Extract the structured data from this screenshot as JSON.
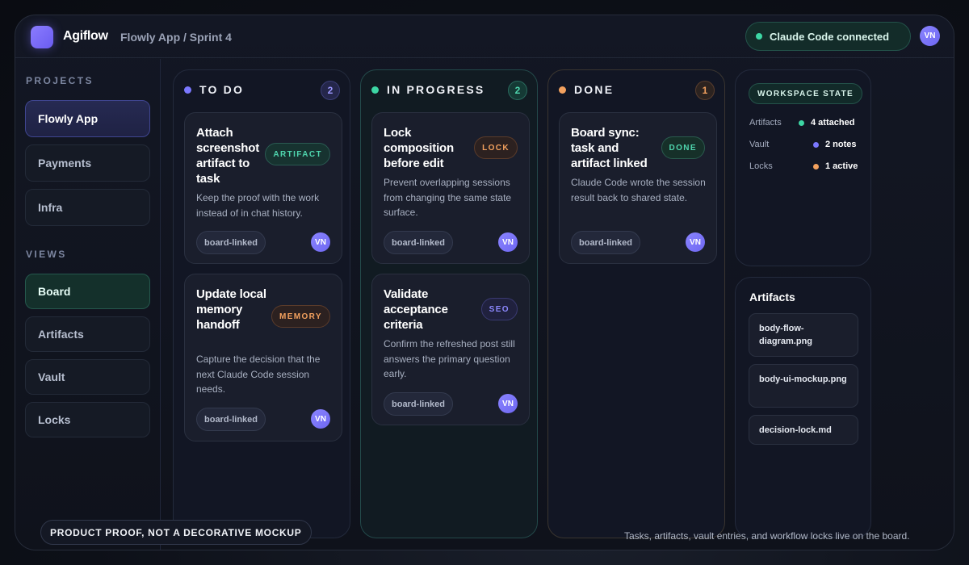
{
  "app": {
    "brand": "Agiflow",
    "breadcrumb": "Flowly App / Sprint 4",
    "status": "Claude Code connected",
    "user_initials": "VN"
  },
  "sidebar": {
    "projects_label": "PROJECTS",
    "projects": [
      {
        "label": "Flowly App",
        "active": true
      },
      {
        "label": "Payments"
      },
      {
        "label": "Infra"
      }
    ],
    "views_label": "VIEWS",
    "views": [
      {
        "label": "Board",
        "active": true
      },
      {
        "label": "Artifacts"
      },
      {
        "label": "Vault"
      },
      {
        "label": "Locks"
      }
    ]
  },
  "columns": [
    {
      "title": "TO DO",
      "count": "2",
      "dot_color": "#7b78ff",
      "cards": [
        {
          "title": "Attach screenshot artifact to task",
          "tag": "ARTIFACT",
          "desc": "Keep the proof with the work instead of in chat history.",
          "chip": "board-linked",
          "avatar": "VN"
        },
        {
          "title": "Update local memory handoff",
          "tag": "MEMORY",
          "desc": "Capture the decision that the next Claude Code session needs.",
          "chip": "board-linked",
          "avatar": "VN"
        }
      ]
    },
    {
      "title": "IN PROGRESS",
      "count": "2",
      "dot_color": "#3dd6a4",
      "cards": [
        {
          "title": "Lock composition before edit",
          "tag": "LOCK",
          "desc": "Prevent overlapping sessions from changing the same state surface.",
          "chip": "board-linked",
          "avatar": "VN"
        },
        {
          "title": "Validate acceptance criteria",
          "tag": "SEO",
          "desc": "Confirm the refreshed post still answers the primary question early.",
          "chip": "board-linked",
          "avatar": "VN"
        }
      ]
    },
    {
      "title": "DONE",
      "count": "1",
      "dot_color": "#f3a15e",
      "cards": [
        {
          "title": "Board sync: task and artifact linked",
          "tag": "DONE",
          "desc": "Claude Code wrote the session result back to shared state.",
          "chip": "board-linked",
          "avatar": "VN"
        }
      ]
    }
  ],
  "workspace": {
    "badge": "WORKSPACE STATE",
    "rows": [
      {
        "key": "Artifacts",
        "value": "4 attached",
        "dot_color": "#3dd6a4"
      },
      {
        "key": "Vault",
        "value": "2 notes",
        "dot_color": "#7b78ff"
      },
      {
        "key": "Locks",
        "value": "1 active",
        "dot_color": "#f3a15e"
      }
    ]
  },
  "artifacts_panel": {
    "title": "Artifacts",
    "files": [
      "body-flow-diagram.png",
      "body-ui-mockup.png",
      "decision-lock.md"
    ]
  },
  "footer": {
    "badge": "PRODUCT PROOF, NOT A DECORATIVE MOCKUP",
    "note": "Tasks, artifacts, vault entries, and workflow locks live on the board."
  }
}
